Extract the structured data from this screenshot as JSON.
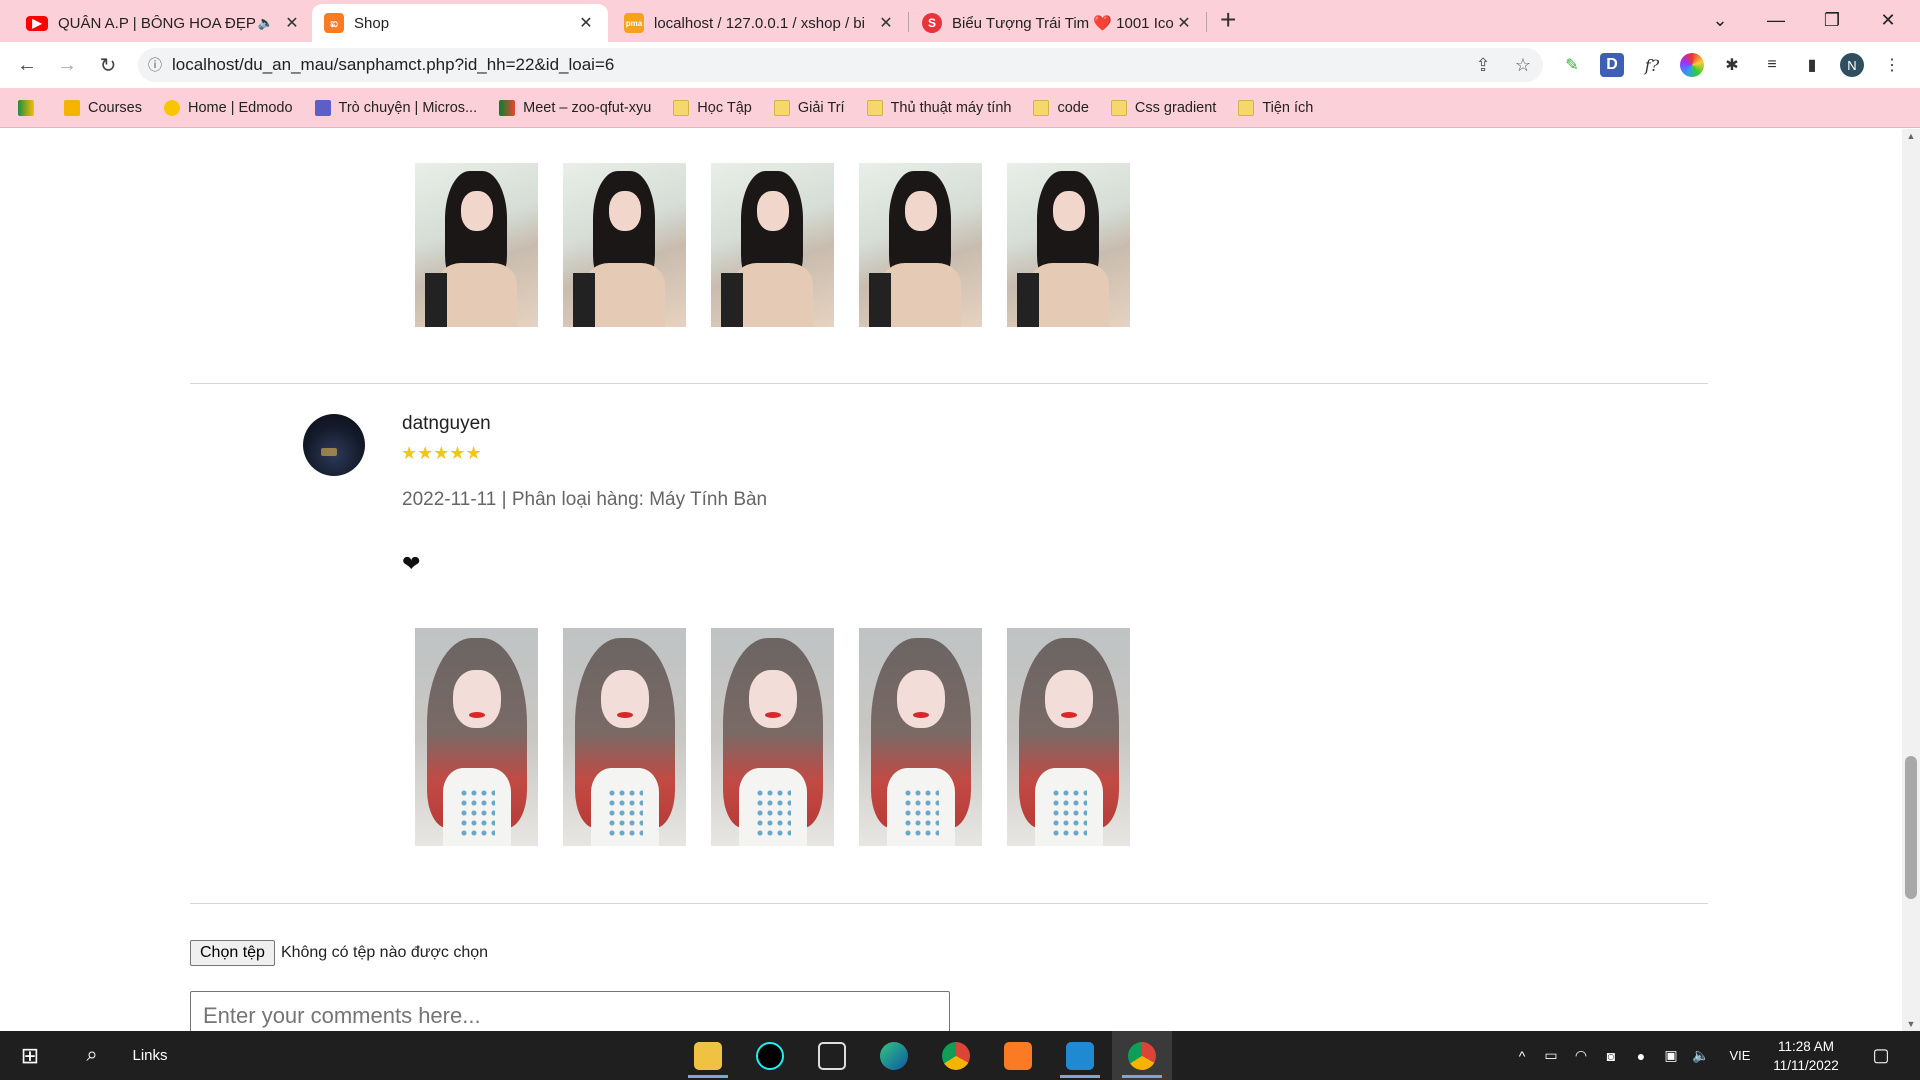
{
  "browser": {
    "tabs": [
      {
        "title": "QUÂN A.P | BÔNG HOA ĐẸP",
        "favicon": "youtube-icon",
        "color": "#ff0000",
        "active": false,
        "audio": true
      },
      {
        "title": "Shop",
        "favicon": "xampp-icon",
        "color": "#fb7a24",
        "active": true,
        "audio": false
      },
      {
        "title": "localhost / 127.0.0.1 / xshop / bi",
        "favicon": "phpmyadmin-icon",
        "color": "#f6a21b",
        "active": false,
        "audio": false
      },
      {
        "title": "Biểu Tượng Trái Tim ❤️ 1001 Ico",
        "favicon": "site-s-icon",
        "color": "#e8333a",
        "active": false,
        "audio": false
      }
    ],
    "new_tab": "+",
    "url": "localhost/du_an_mau/sanphamct.php?id_hh=22&id_loai=6",
    "profile_initial": "N",
    "bookmarks": [
      {
        "label": "",
        "icon": "google-meet-icon"
      },
      {
        "label": "Courses",
        "icon": "classroom-icon"
      },
      {
        "label": "Home | Edmodo",
        "icon": "edmodo-icon"
      },
      {
        "label": "Trò chuyện | Micros...",
        "icon": "teams-icon"
      },
      {
        "label": "Meet – zoo-qfut-xyu",
        "icon": "google-meet-icon"
      },
      {
        "label": "Học Tập",
        "icon": "folder-icon"
      },
      {
        "label": "Giải Trí",
        "icon": "folder-icon"
      },
      {
        "label": "Thủ thuật máy tính",
        "icon": "folder-icon"
      },
      {
        "label": "code",
        "icon": "folder-icon"
      },
      {
        "label": "Css gradient",
        "icon": "folder-icon"
      },
      {
        "label": "Tiện ích",
        "icon": "folder-icon"
      }
    ]
  },
  "review": {
    "username": "datnguyen",
    "rating": 5,
    "stars": "★★★★★",
    "meta": "2022-11-11 | Phân loại hàng: Máy Tính Bàn",
    "content": "❤"
  },
  "form": {
    "file_button": "Chọn tệp",
    "file_status": "Không có tệp nào được chọn",
    "comment_placeholder": "Enter your comments here..."
  },
  "taskbar": {
    "search_label": "Links",
    "lang": "VIE",
    "time": "11:28 AM",
    "date": "11/11/2022"
  }
}
